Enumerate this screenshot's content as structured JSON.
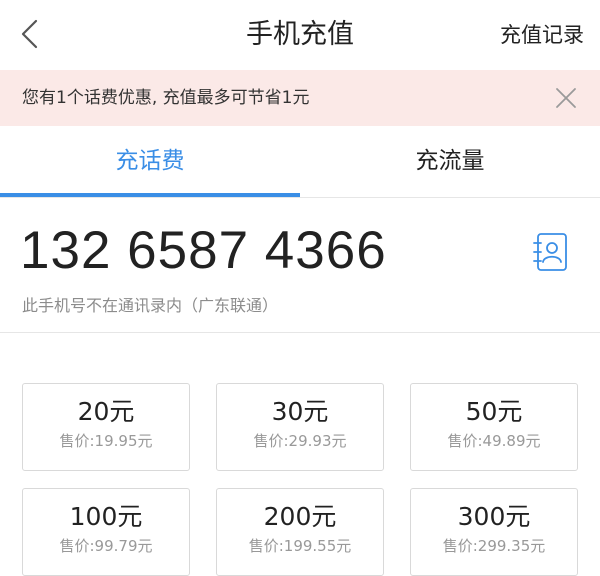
{
  "header": {
    "title": "手机充值",
    "records_link": "充值记录"
  },
  "promo": {
    "text": "您有1个话费优惠, 充值最多可节省1元"
  },
  "tabs": [
    {
      "label": "充话费",
      "active": true
    },
    {
      "label": "充流量",
      "active": false
    }
  ],
  "phone": {
    "number": "132 6587 4366",
    "hint": "此手机号不在通讯录内（广东联通）"
  },
  "options": [
    {
      "amount": "20元",
      "price": "售价:19.95元"
    },
    {
      "amount": "30元",
      "price": "售价:29.93元"
    },
    {
      "amount": "50元",
      "price": "售价:49.89元"
    },
    {
      "amount": "100元",
      "price": "售价:99.79元"
    },
    {
      "amount": "200元",
      "price": "售价:199.55元"
    },
    {
      "amount": "300元",
      "price": "售价:299.35元"
    }
  ],
  "colors": {
    "accent": "#3a8ee6",
    "promo_bg": "#fbe9e7",
    "muted_text": "#999999"
  },
  "icons": {
    "back": "chevron-left-icon",
    "close": "close-icon",
    "contacts": "contact-book-icon"
  }
}
